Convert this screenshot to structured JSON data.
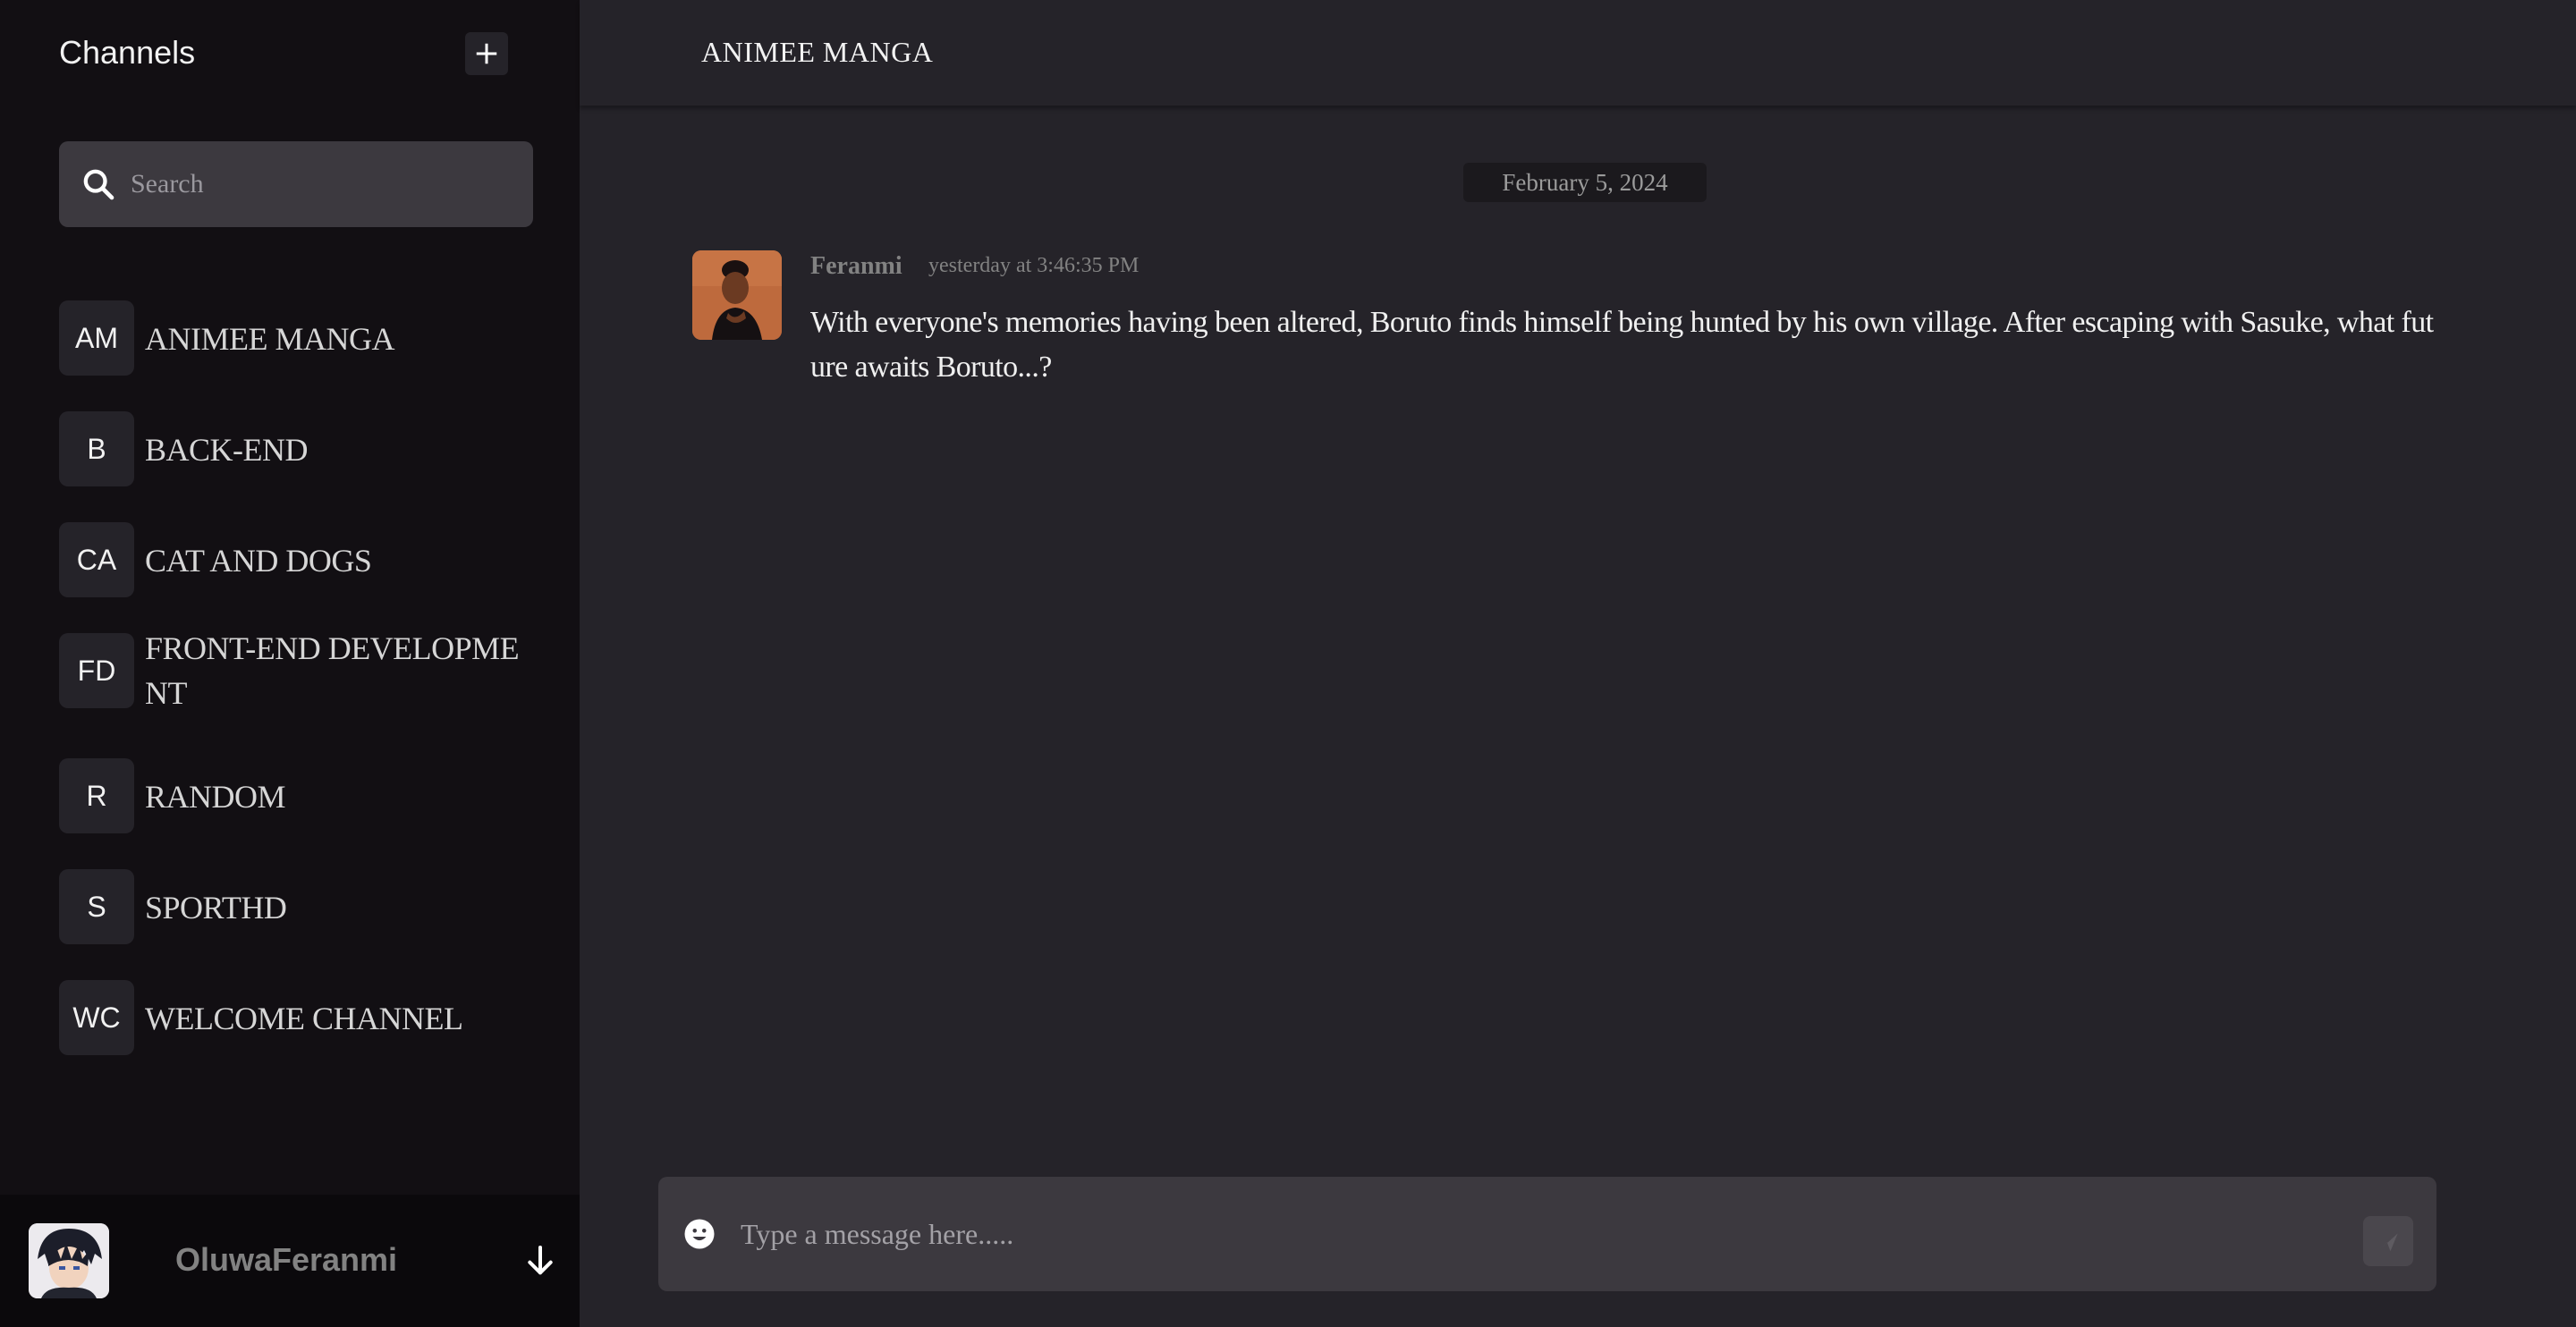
{
  "sidebar": {
    "title": "Channels",
    "search_placeholder": "Search",
    "channels": [
      {
        "initials": "AM",
        "name": "ANIMEE MANGA"
      },
      {
        "initials": "B",
        "name": "BACK-END"
      },
      {
        "initials": "CA",
        "name": "CAT AND DOGS"
      },
      {
        "initials": "FD",
        "name": "FRONT-END DEVELOPMENT"
      },
      {
        "initials": "R",
        "name": "RANDOM"
      },
      {
        "initials": "S",
        "name": "SPORTHD"
      },
      {
        "initials": "WC",
        "name": "WELCOME CHANNEL"
      }
    ],
    "user": {
      "name": "OluwaFeranmi"
    }
  },
  "main": {
    "channel_title": "ANIMEE MANGA",
    "date_divider": "February 5, 2024",
    "messages": [
      {
        "author": "Feranmi",
        "time": "yesterday at 3:46:35 PM",
        "text": "With everyone's memories having been altered, Boruto finds himself being hunted by his own village. After escaping with Sasuke, what future awaits Boruto...?"
      }
    ],
    "composer": {
      "placeholder": "Type a message here....."
    }
  },
  "icons": {
    "add": "plus-icon",
    "search": "search-icon",
    "menu": "arrow-down-icon",
    "emoji": "smiley-icon",
    "send": "send-icon"
  },
  "colors": {
    "sidebar_bg": "#120F13",
    "main_bg": "#252329",
    "input_bg": "#3C393F",
    "muted_text": "#828282"
  }
}
